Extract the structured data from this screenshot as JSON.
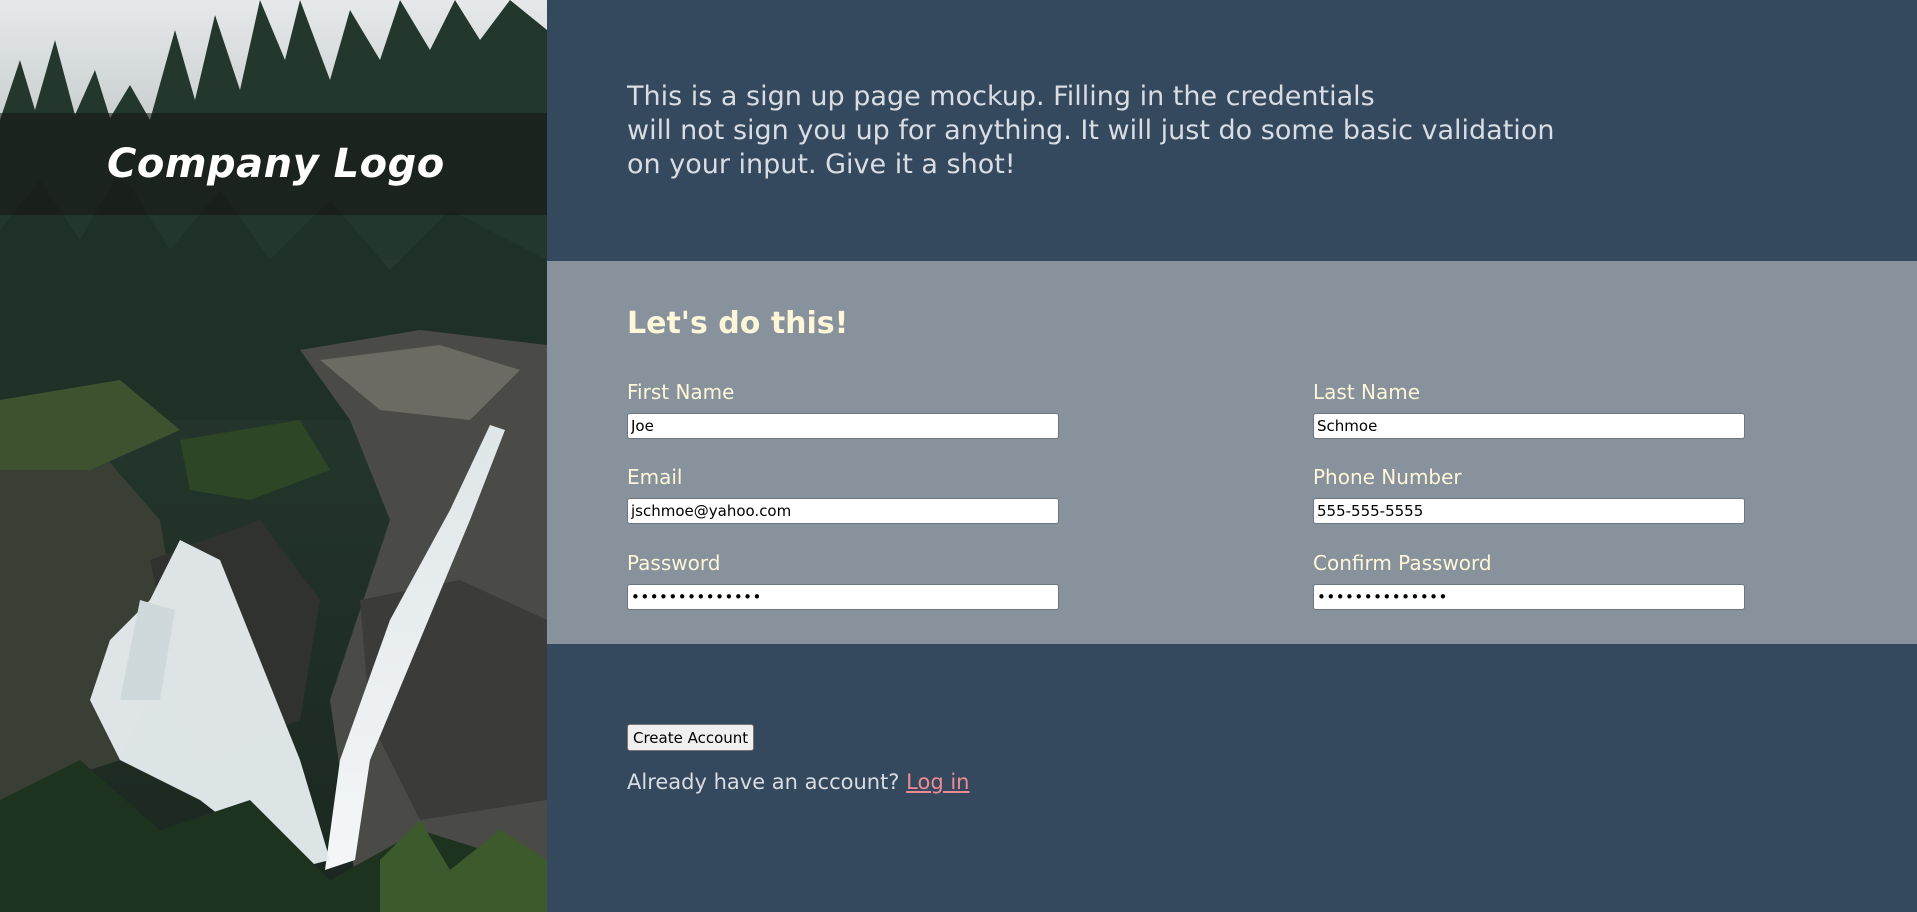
{
  "hero": {
    "logo_text": "Company Logo",
    "image": "waterfall-forest-photo"
  },
  "intro": {
    "lines": [
      "This is a sign up page mockup. Filling in the credentials",
      "will not sign you up for anything. It will just do some basic validation",
      "on your input. Give it a shot!"
    ]
  },
  "form": {
    "heading": "Let's do this!",
    "fields": {
      "first_name": {
        "label": "First Name",
        "value": "Joe"
      },
      "last_name": {
        "label": "Last Name",
        "value": "Schmoe"
      },
      "email": {
        "label": "Email",
        "value": "jschmoe@yahoo.com"
      },
      "phone": {
        "label": "Phone Number",
        "value": "555-555-5555"
      },
      "password": {
        "label": "Password",
        "value": "password123456"
      },
      "confirm_password": {
        "label": "Confirm Password",
        "value": "password123456"
      }
    }
  },
  "actions": {
    "create_account_label": "Create Account",
    "login_prompt": "Already have an account? ",
    "login_link": "Log in"
  },
  "colors": {
    "content_bg": "#34495e",
    "form_bg": "#87929c",
    "label_text": "#fdf6d8",
    "link": "#f08a92"
  }
}
